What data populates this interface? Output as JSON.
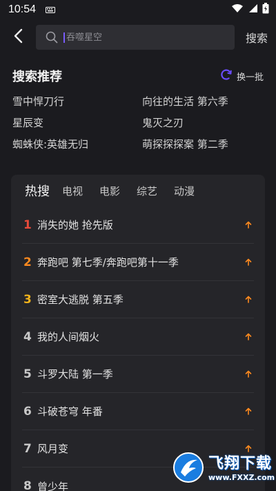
{
  "status_bar": {
    "time": "10:54"
  },
  "header": {
    "search_placeholder": "吞噬星空",
    "search_button": "搜索"
  },
  "recommend": {
    "title": "搜索推荐",
    "refresh_label": "换一批",
    "items": [
      "雪中悍刀行",
      "向往的生活 第六季",
      "星辰变",
      "鬼灭之刃",
      "蜘蛛侠:英雄无归",
      "萌探探探案 第二季"
    ]
  },
  "hot": {
    "tabs": [
      "热搜",
      "电视",
      "电影",
      "综艺",
      "动漫"
    ],
    "active_tab": "热搜",
    "items": [
      {
        "rank": "1",
        "title": "消失的她 抢先版"
      },
      {
        "rank": "2",
        "title": "奔跑吧 第七季/奔跑吧第十一季"
      },
      {
        "rank": "3",
        "title": "密室大逃脱 第五季"
      },
      {
        "rank": "4",
        "title": "我的人间烟火"
      },
      {
        "rank": "5",
        "title": "斗罗大陆 第一季"
      },
      {
        "rank": "6",
        "title": "斗破苍穹 年番"
      },
      {
        "rank": "7",
        "title": "风月变"
      },
      {
        "rank": "8",
        "title": "曾少年"
      }
    ]
  },
  "watermark": {
    "brand": "飞翔下载",
    "url": "www.FXXZ.com"
  },
  "colors": {
    "background": "#1b1b1f",
    "card": "#252529",
    "rank1": "#e84a3a",
    "rank2": "#ff8a1f",
    "rank3": "#f2b21b",
    "trend_up": "#ff8a1f",
    "refresh_icon": "#6a4cff"
  },
  "icons": {
    "back": "back-arrow-icon",
    "search": "search-icon",
    "refresh": "refresh-icon",
    "trend": "trend-up-icon"
  }
}
